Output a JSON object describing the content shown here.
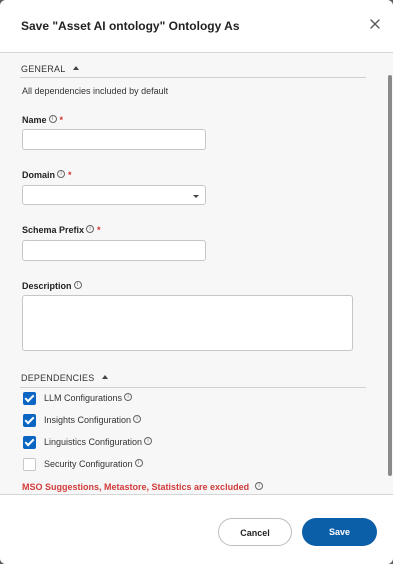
{
  "dialog": {
    "title": "Save \"Asset AI ontology\" Ontology As",
    "close_icon": "close-icon"
  },
  "general": {
    "heading": "GENERAL",
    "note": "All dependencies included by default"
  },
  "fields": {
    "name": {
      "label": "Name",
      "value": "",
      "required": true
    },
    "domain": {
      "label": "Domain",
      "value": "",
      "required": true
    },
    "schema_prefix": {
      "label": "Schema Prefix",
      "value": "",
      "required": true
    },
    "description": {
      "label": "Description",
      "value": "",
      "required": false
    }
  },
  "dependencies": {
    "heading": "DEPENDENCIES",
    "items": [
      {
        "label": "LLM Configurations",
        "checked": true
      },
      {
        "label": "Insights Configuration",
        "checked": true
      },
      {
        "label": "Linguistics Configuration",
        "checked": true
      },
      {
        "label": "Security Configuration",
        "checked": false
      }
    ],
    "excluded_note": "MSO Suggestions, Metastore, Statistics are excluded"
  },
  "footer": {
    "cancel_label": "Cancel",
    "save_label": "Save"
  },
  "colors": {
    "accent": "#0b66c3",
    "save_button": "#0b5ea8",
    "warning": "#d13b3b",
    "required": "#d32f2f"
  }
}
